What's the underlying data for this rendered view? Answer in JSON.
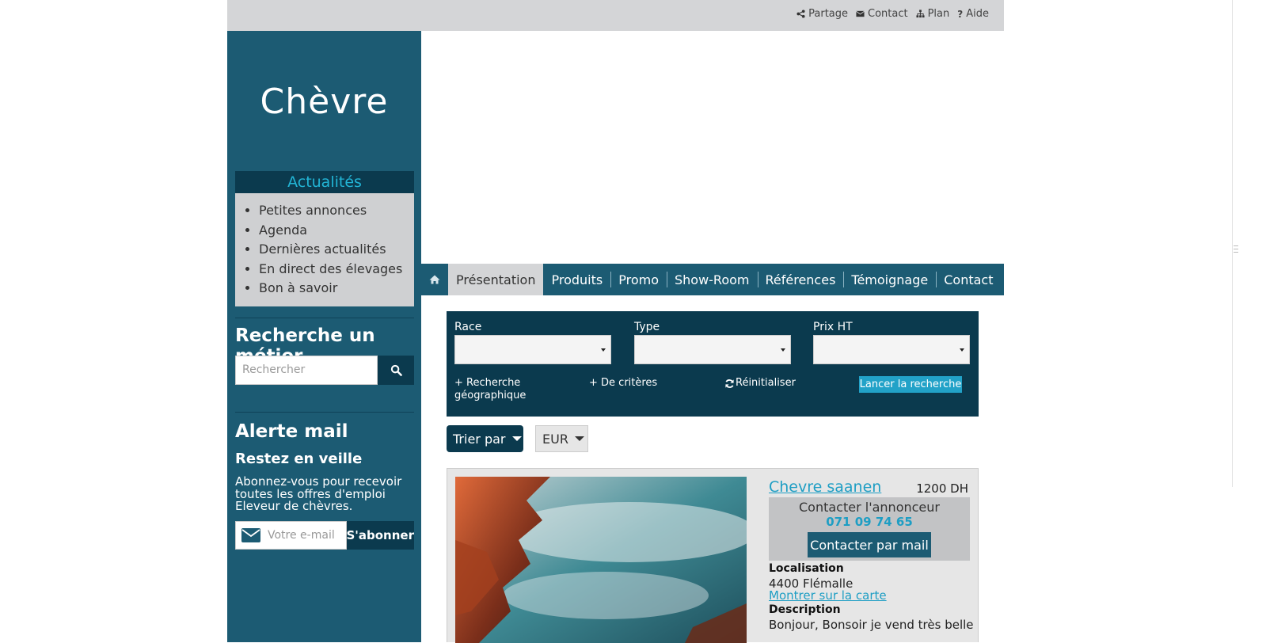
{
  "toplinks": [
    {
      "icon": "share-icon",
      "label": "Partage"
    },
    {
      "icon": "envelope-icon",
      "label": "Contact"
    },
    {
      "icon": "sitemap-icon",
      "label": "Plan"
    },
    {
      "icon": "question-icon",
      "label": "Aide"
    }
  ],
  "sidebar": {
    "site_title": "Chèvre",
    "news_title": "Actualités",
    "news_items": [
      "Petites annonces",
      "Agenda",
      "Dernières actualités",
      "En direct des élevages",
      "Bon à savoir"
    ],
    "search_heading": "Recherche un métier",
    "search_placeholder": "Rechercher",
    "alert_heading": "Alerte mail",
    "alert_subheading": "Restez en veille",
    "alert_text": "Abonnez-vous pour recevoir toutes les offres d'emploi Eleveur de chèvres.",
    "email_placeholder": "Votre e-mail",
    "subscribe_label": "S'abonner"
  },
  "nav": {
    "home_icon": "home-icon",
    "items": [
      "Présentation",
      "Produits",
      "Promo",
      "Show-Room",
      "Références",
      "Témoignage",
      "Contact"
    ],
    "active": "Présentation"
  },
  "filter": {
    "race_label": "Race",
    "type_label": "Type",
    "price_label": "Prix HT",
    "race_value": "",
    "type_value": "",
    "price_value": "",
    "geo_link": "+ Recherche géographique",
    "criteria_link": "+ De critères",
    "reset_label": "Réinitialiser",
    "search_button": "Lancer la recherche"
  },
  "sort": {
    "label": "Trier par",
    "currency": "EUR"
  },
  "listing": {
    "title": "Chevre saanen",
    "price": "1200 DH",
    "contact_label": "Contacter l'annonceur",
    "phone": "071 09 74 65",
    "mail_button": "Contacter par mail",
    "location_label": "Localisation",
    "location_value": "4400 Flémalle",
    "map_link": "Montrer sur la carte",
    "description_label": "Description",
    "description_value": "Bonjour, Bonsoir je vend très belle"
  },
  "colors": {
    "accent": "#1c5b73",
    "dark": "#0b3a4e",
    "link": "#1e9ec4",
    "highlight": "#22b5d6"
  }
}
